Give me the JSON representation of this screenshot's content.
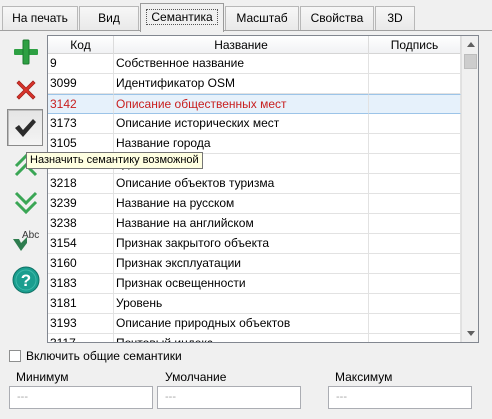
{
  "tabs": [
    {
      "label": "На печать"
    },
    {
      "label": "Вид"
    },
    {
      "label": "Семантика"
    },
    {
      "label": "Масштаб"
    },
    {
      "label": "Свойства"
    },
    {
      "label": "3D"
    }
  ],
  "toolbar": {
    "buttons": [
      {
        "icon": "plus-icon"
      },
      {
        "icon": "delete-x-icon"
      },
      {
        "icon": "checkmark-icon"
      },
      {
        "icon": "chevron-up-double-icon"
      },
      {
        "icon": "chevron-down-double-icon"
      },
      {
        "icon": "spellcheck-icon",
        "text": "Abc"
      },
      {
        "icon": "help-icon",
        "text": "?"
      }
    ],
    "tooltip": "Назначить семантику возможной"
  },
  "table": {
    "columns": [
      "Код",
      "Название",
      "Подпись"
    ],
    "selected_row": 2,
    "rows": [
      {
        "code": "9",
        "name": "Собственное название",
        "caption": ""
      },
      {
        "code": "3099",
        "name": "Идентификатор OSM",
        "caption": ""
      },
      {
        "code": "3142",
        "name": "Описание общественных мест",
        "caption": ""
      },
      {
        "code": "3173",
        "name": "Описание исторических мест",
        "caption": ""
      },
      {
        "code": "3105",
        "name": "Название города",
        "caption": ""
      },
      {
        "code": "",
        "name": "туры",
        "caption": ""
      },
      {
        "code": "3218",
        "name": "Описание объектов туризма",
        "caption": ""
      },
      {
        "code": "3239",
        "name": "Название на русском",
        "caption": ""
      },
      {
        "code": "3238",
        "name": "Название на английском",
        "caption": ""
      },
      {
        "code": "3154",
        "name": "Признак закрытого объекта",
        "caption": ""
      },
      {
        "code": "3160",
        "name": "Признак эксплуатации",
        "caption": ""
      },
      {
        "code": "3183",
        "name": "Признак освещенности",
        "caption": ""
      },
      {
        "code": "3181",
        "name": "Уровень",
        "caption": ""
      },
      {
        "code": "3193",
        "name": "Описание природных объектов",
        "caption": ""
      },
      {
        "code": "3117",
        "name": "Почтовый индекс",
        "caption": ""
      }
    ]
  },
  "include_common": {
    "label": "Включить общие семантики",
    "checked": false
  },
  "fields": {
    "min": {
      "label": "Минимум",
      "value": "---"
    },
    "default": {
      "label": "Умолчание",
      "value": "---"
    },
    "max": {
      "label": "Максимум",
      "value": "---"
    }
  },
  "colors": {
    "selected_text": "#c81f1f",
    "selected_bg": "#e6f1fb",
    "plus": "#2ea043",
    "delete": "#d9342b",
    "help": "#1a9e8f"
  }
}
